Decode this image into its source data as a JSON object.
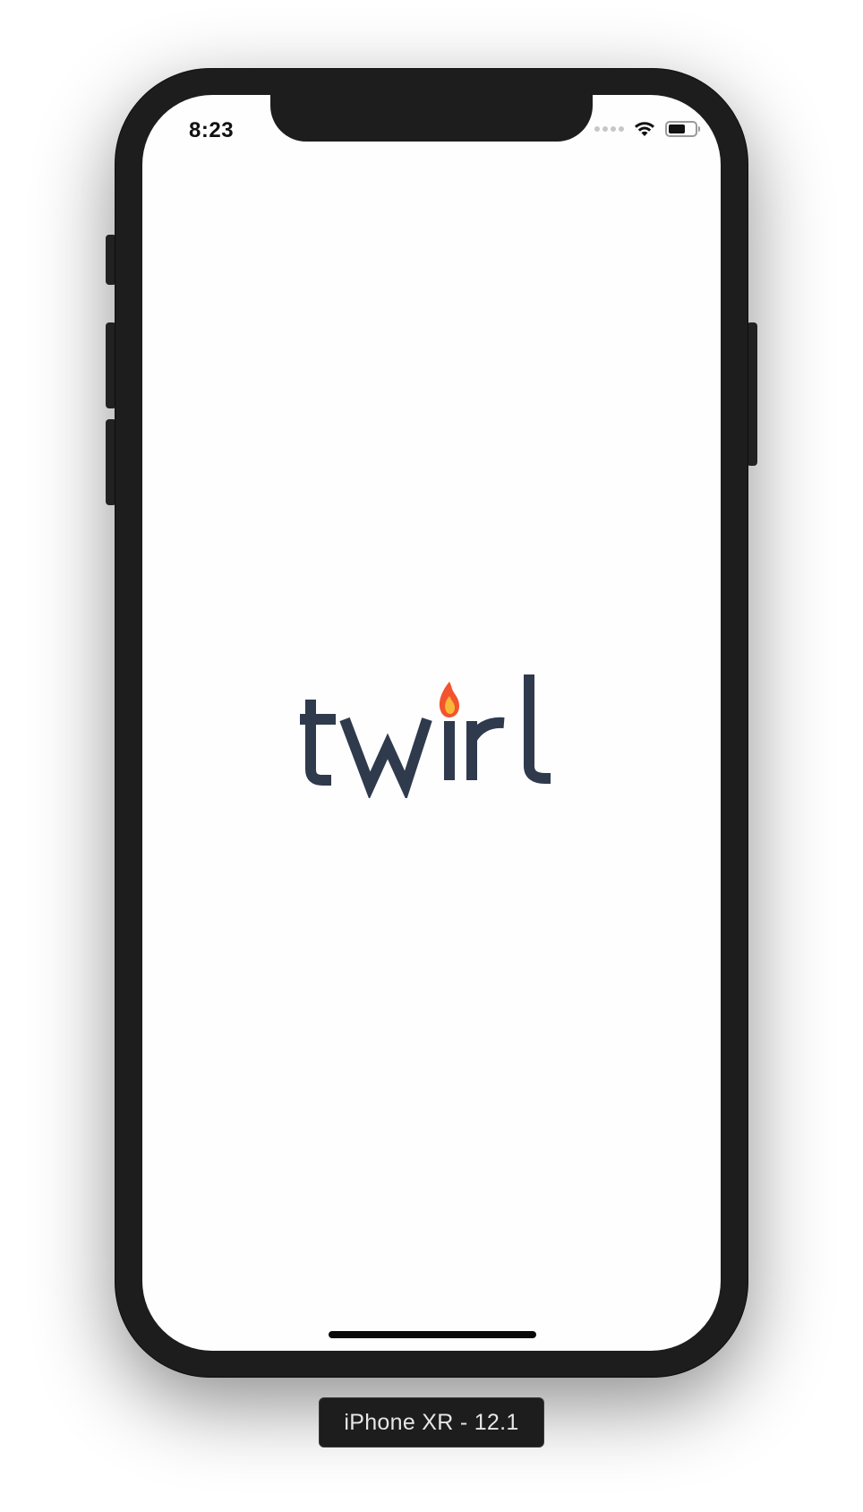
{
  "status_bar": {
    "time": "8:23",
    "signal_icon": "cellular-signal-dots",
    "wifi_icon": "wifi-icon",
    "battery_icon": "battery-icon",
    "battery_level": 0.65
  },
  "splash": {
    "logo_text": "twirl",
    "colors": {
      "wordmark": "#2f3a4d",
      "flame_outer": "#f2542d",
      "flame_inner": "#f8b93a"
    }
  },
  "simulator": {
    "device_label": "iPhone XR - 12.1"
  }
}
